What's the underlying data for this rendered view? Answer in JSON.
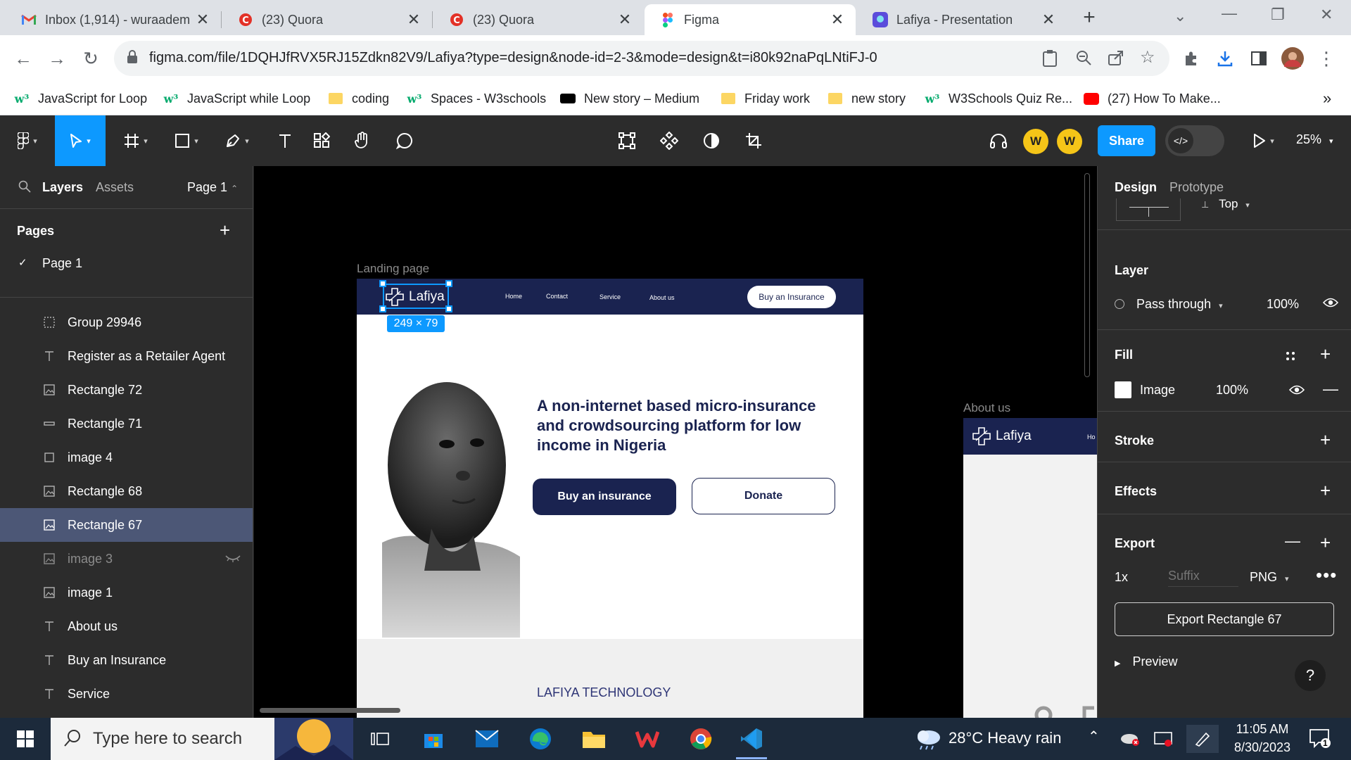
{
  "browser": {
    "tabs": [
      {
        "title": "Inbox (1,914) - wuraadem",
        "icon": "gmail-icon",
        "active": false
      },
      {
        "title": "(23) Quora",
        "icon": "quora-icon",
        "active": false
      },
      {
        "title": "(23) Quora",
        "icon": "quora-icon",
        "active": false
      },
      {
        "title": "Figma",
        "icon": "figma-icon",
        "active": true
      },
      {
        "title": "Lafiya - Presentation",
        "icon": "canva-icon",
        "active": false
      }
    ],
    "url": "figma.com/file/1DQHJfRVX5RJ15Zdkn82V9/Lafiya?type=design&node-id=2-3&mode=design&t=i80k92naPqLNtiFJ-0",
    "bookmarks": [
      {
        "label": "JavaScript for Loop",
        "icon": "w3schools-icon"
      },
      {
        "label": "JavaScript while Loop",
        "icon": "w3schools-icon"
      },
      {
        "label": "coding",
        "icon": "folder-icon"
      },
      {
        "label": "Spaces - W3schools",
        "icon": "w3schools-icon"
      },
      {
        "label": "New story – Medium",
        "icon": "medium-icon"
      },
      {
        "label": "Friday work",
        "icon": "folder-icon"
      },
      {
        "label": "new story",
        "icon": "folder-icon"
      },
      {
        "label": "W3Schools Quiz Re...",
        "icon": "w3schools-icon"
      },
      {
        "label": "(27) How To Make...",
        "icon": "youtube-icon"
      }
    ],
    "more_bookmarks": "»"
  },
  "figma": {
    "avatars": [
      "W",
      "W"
    ],
    "share_label": "Share",
    "zoom": "25%",
    "left": {
      "tab_layers": "Layers",
      "tab_assets": "Assets",
      "page_selector": "Page 1",
      "pages_header": "Pages",
      "pages": [
        {
          "name": "Page 1",
          "current": true
        }
      ],
      "layers": [
        {
          "name": "Group 29946",
          "icon": "frame-dashed-icon"
        },
        {
          "name": "Register as a Retailer Agent",
          "icon": "text-icon"
        },
        {
          "name": "Rectangle 72",
          "icon": "image-icon"
        },
        {
          "name": "Rectangle 71",
          "icon": "line-icon"
        },
        {
          "name": "image 4",
          "icon": "rectangle-icon"
        },
        {
          "name": "Rectangle 68",
          "icon": "image-icon"
        },
        {
          "name": "Rectangle 67",
          "icon": "image-icon",
          "selected": true
        },
        {
          "name": "image 3",
          "icon": "image-icon",
          "hidden": true
        },
        {
          "name": "image 1",
          "icon": "image-icon"
        },
        {
          "name": "About us",
          "icon": "text-icon"
        },
        {
          "name": "Buy an Insurance",
          "icon": "text-icon"
        },
        {
          "name": "Service",
          "icon": "text-icon"
        }
      ]
    },
    "canvas": {
      "landing_label": "Landing page",
      "about_label": "About us",
      "selection_size": "249 × 79",
      "logo_text": "Lafiya",
      "nav": [
        "Home",
        "Contact",
        "Service",
        "About us"
      ],
      "nav_cta": "Buy an Insurance",
      "headline": "A non-internet based micro-insurance and crowdsourcing platform for low income in Nigeria",
      "hero_buy": "Buy an insurance",
      "hero_donate": "Donate",
      "section_title": "LAFIYA TECHNOLOGY",
      "about_nav_partial": "Ho"
    },
    "right": {
      "tab_design": "Design",
      "tab_prototype": "Prototype",
      "constraint_vertical": "Top",
      "layer_title": "Layer",
      "blend_mode": "Pass through",
      "layer_opacity": "100%",
      "fill_title": "Fill",
      "fill_type": "Image",
      "fill_opacity": "100%",
      "stroke_title": "Stroke",
      "effects_title": "Effects",
      "export_title": "Export",
      "export_scale": "1x",
      "export_suffix_placeholder": "Suffix",
      "export_format": "PNG",
      "export_button": "Export Rectangle 67",
      "preview_label": "Preview",
      "help": "?"
    }
  },
  "taskbar": {
    "search_placeholder": "Type here to search",
    "weather": "28°C  Heavy rain",
    "time": "11:05 AM",
    "date": "8/30/2023",
    "notification_count": "1"
  },
  "colors": {
    "figma_blue": "#0d99ff",
    "lafiya_navy": "#1a2350",
    "selected_layer": "#4c5776"
  }
}
